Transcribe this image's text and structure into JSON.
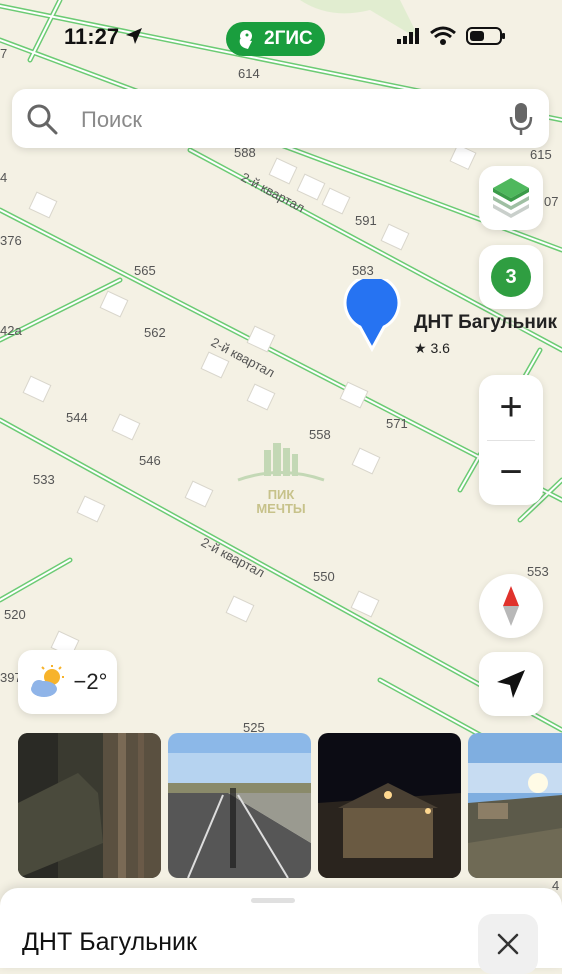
{
  "status_bar": {
    "time": "11:27",
    "brand": "2ГИС"
  },
  "search": {
    "placeholder": "Поиск"
  },
  "controls": {
    "results_count": "3",
    "zoom_in": "+",
    "zoom_out": "−"
  },
  "weather": {
    "temperature": "−2°"
  },
  "poi": {
    "name": "ДНТ Багульник",
    "rating": "★ 3.6"
  },
  "map": {
    "street_labels": [
      "2-й квартал",
      "2-й квартал",
      "2-й квартал"
    ],
    "house_numbers": [
      "614",
      "588",
      "615",
      "591",
      "583",
      "565",
      "562",
      "544",
      "546",
      "533",
      "558",
      "571",
      "550",
      "553",
      "520",
      "525",
      "376",
      "42a",
      "397",
      "07",
      "4",
      "7",
      "4"
    ],
    "watermark_lines": [
      "ПИК",
      "МЕЧТЫ"
    ]
  },
  "photos": [
    "photo-1",
    "photo-2",
    "photo-3",
    "photo-4"
  ],
  "bottom_sheet": {
    "title": "ДНТ Багульник"
  },
  "colors": {
    "map_background": "#f4f1e4",
    "road": "#6ccb74",
    "brand_green": "#1a9e3e",
    "pin_blue": "#2673f2",
    "badge_green": "#2f9e41"
  }
}
